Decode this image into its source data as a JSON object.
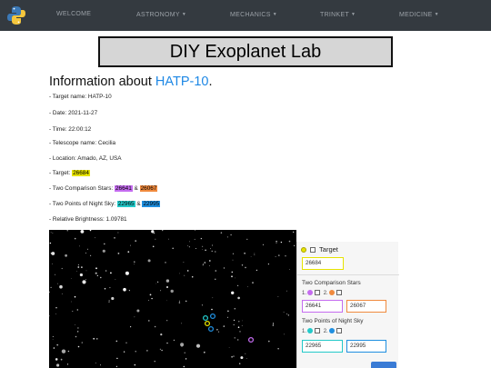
{
  "nav": {
    "items": [
      {
        "label": "WELCOME",
        "dropdown": false
      },
      {
        "label": "ASTRONOMY",
        "dropdown": true
      },
      {
        "label": "MECHANICS",
        "dropdown": true
      },
      {
        "label": "TRINKET",
        "dropdown": true
      },
      {
        "label": "MEDICINE",
        "dropdown": true
      }
    ],
    "logo_icon": "python-logo-icon"
  },
  "page": {
    "title": "DIY Exoplanet Lab"
  },
  "info": {
    "heading_prefix": "Information about ",
    "heading_target": "HATP-10",
    "heading_suffix": ".",
    "target_name": "- Target name: HATP-10",
    "date": "- Date: 2021-11-27",
    "time": "- Time: 22:00:12",
    "telescope": "- Telescope name: Cecilia",
    "location": "- Location: Amado, AZ, USA",
    "target_prefix": "- Target: ",
    "target_id": "26684",
    "comparison_prefix": "- Two Comparison Stars: ",
    "comparison_a": "26641",
    "comparison_amp": " & ",
    "comparison_b": "26067",
    "sky_prefix": "- Two Points of Night Sky: ",
    "sky_a": "22965",
    "sky_amp": " & ",
    "sky_b": "22995",
    "brightness": "- Relative Brightness: 1.09781"
  },
  "panel": {
    "target_label": "Target",
    "target_value": "26684",
    "comparison_title": "Two Comparison Stars",
    "comparison_pick_1": "1.",
    "comparison_pick_2": "2.",
    "comparison_value_1": "26641",
    "comparison_value_2": "26067",
    "sky_title": "Two Points of Night Sky",
    "sky_pick_1": "1.",
    "sky_pick_2": "2.",
    "sky_value_1": "22965",
    "sky_value_2": "22995"
  },
  "colors": {
    "navbar": "#343a40",
    "link": "#1e88e5",
    "target": "#e6e300",
    "comparison_1": "#c56cf0",
    "comparison_2": "#f08a3e",
    "sky_1": "#23c9c9",
    "sky_2": "#1f8fe0"
  }
}
